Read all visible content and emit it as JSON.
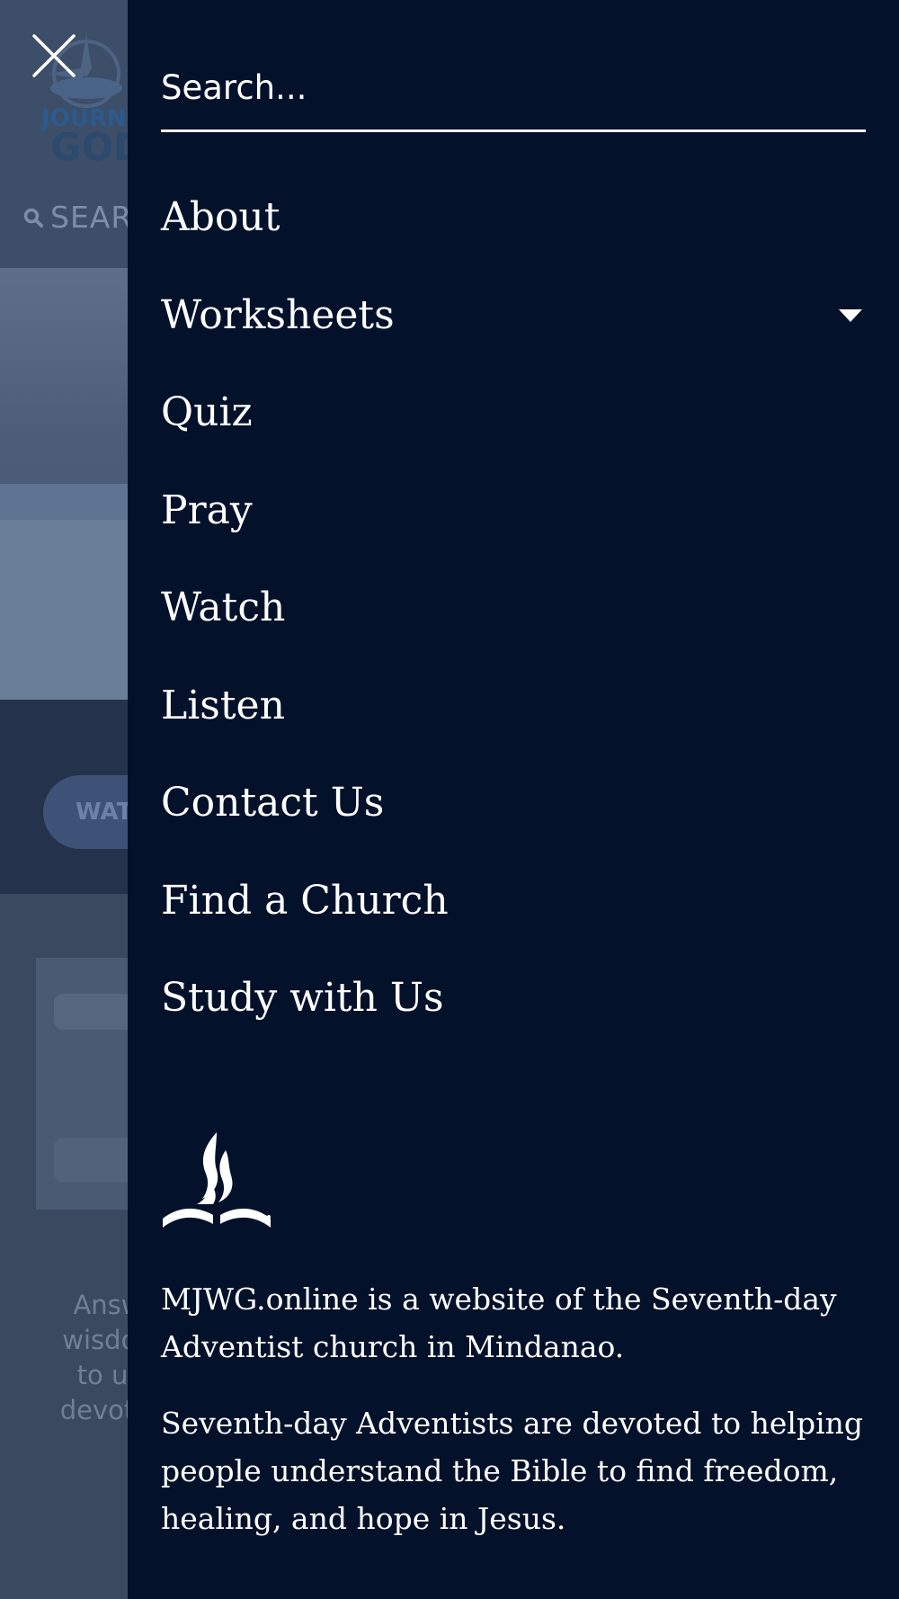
{
  "background": {
    "logo_label": "JOURNEY WITH GOD",
    "search_label": "SEAR",
    "watch_button": "WAT",
    "teaser_lines": [
      "Answ",
      "wisdon",
      "to ur",
      "devotic"
    ]
  },
  "drawer": {
    "close_icon": "close-icon",
    "search": {
      "placeholder": "Search..."
    },
    "menu": [
      {
        "label": "About",
        "has_submenu": false
      },
      {
        "label": "Worksheets",
        "has_submenu": true
      },
      {
        "label": "Quiz",
        "has_submenu": false
      },
      {
        "label": "Pray",
        "has_submenu": false
      },
      {
        "label": "Watch",
        "has_submenu": false
      },
      {
        "label": "Listen",
        "has_submenu": false
      },
      {
        "label": "Contact Us",
        "has_submenu": false
      },
      {
        "label": "Find a Church",
        "has_submenu": false
      },
      {
        "label": "Study with Us",
        "has_submenu": false
      }
    ],
    "logo_icon": "seventh-day-adventist-logo",
    "footer": {
      "paragraph1": "MJWG.online is a website of the Seventh-day Adventist church in Mindanao.",
      "paragraph2": "Seventh-day Adventists are devoted to helping people understand the Bible to find freedom, healing, and hope in Jesus."
    }
  },
  "colors": {
    "drawer_bg": "#04112b",
    "text": "#ffffff",
    "overlay_bg": "#3a4860"
  }
}
